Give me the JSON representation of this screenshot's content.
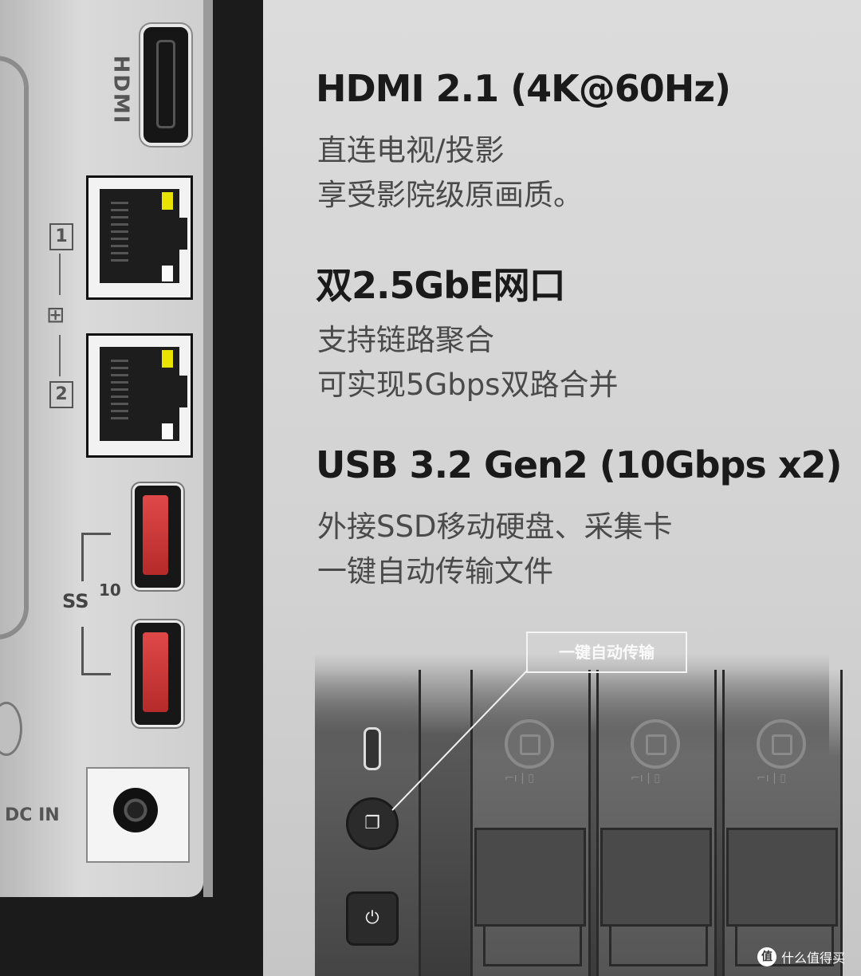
{
  "features": [
    {
      "title": "HDMI 2.1 (4K@60Hz)",
      "lines": [
        "直连电视/投影",
        "享受影院级原画质。"
      ]
    },
    {
      "title": "双2.5GbE网口",
      "lines": [
        "支持链路聚合",
        "可实现5Gbps双路合并"
      ]
    },
    {
      "title": "USB 3.2 Gen2 (10Gbps x2)",
      "lines": [
        "外接SSD移动硬盘、采集卡",
        "一键自动传输文件"
      ]
    }
  ],
  "panel_labels": {
    "hdmi": "HDMI",
    "lan_1": "1",
    "lan_2": "2",
    "usb_speed": "10",
    "usb_symbol": "SS",
    "dc_in": "DC IN"
  },
  "callout": "一键自动传输",
  "nas_front": {
    "copy_button_icon": "copy-icon",
    "power_button_icon": "power-icon",
    "bay_icons": "⌐ı | ▯"
  },
  "watermark": {
    "logo": "值",
    "text": "什么值得买"
  },
  "colors": {
    "usb_port": "#c93838",
    "lan_led": "#e8e400",
    "heading": "#1a1a1a",
    "body_text": "#4a4a4a"
  }
}
